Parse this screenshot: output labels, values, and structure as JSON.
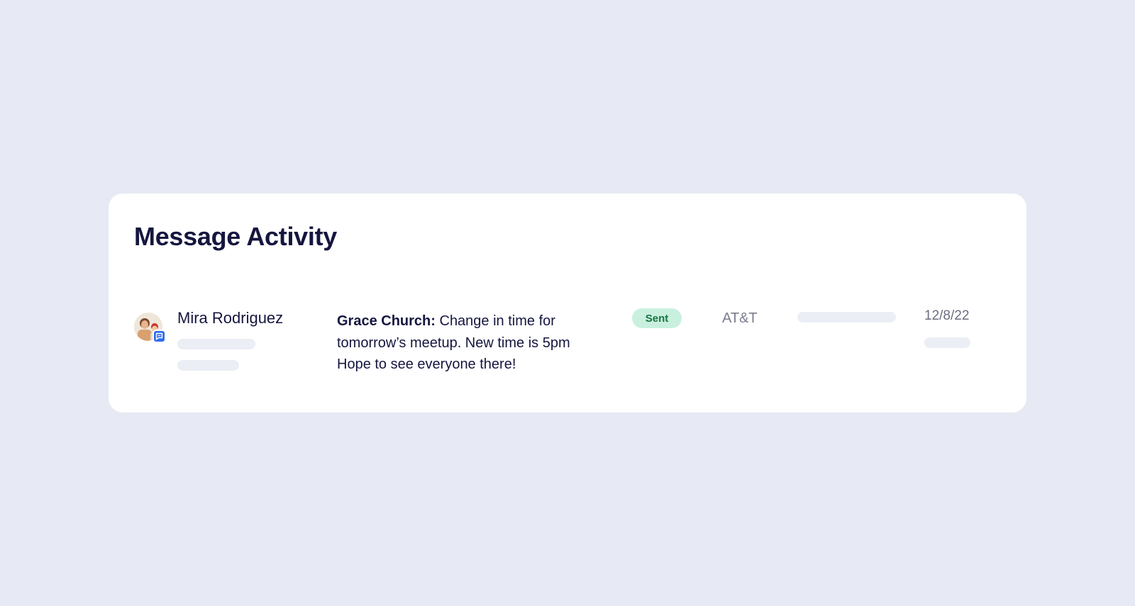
{
  "card": {
    "title": "Message Activity"
  },
  "activity_row": {
    "contact_name": "Mira Rodriguez",
    "avatar_icon": "person-avatar-icon",
    "channel_icon": "chat-bubble-icon",
    "message": {
      "sender": "Grace Church:",
      "body": " Change in time for tomorrow’s meetup. New time is 5pm Hope to see everyone there!"
    },
    "status": "Sent",
    "carrier": "AT&T",
    "date": "12/8/22"
  },
  "colors": {
    "background": "#e7e9f4",
    "card": "#ffffff",
    "text_primary": "#15163f",
    "status_bg": "#c9f0df",
    "status_text": "#17743f",
    "skeleton": "#eceef6",
    "badge": "#2f6cf3"
  }
}
